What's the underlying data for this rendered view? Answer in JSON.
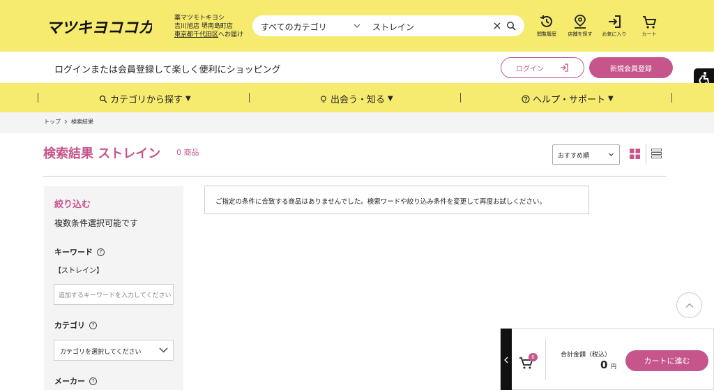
{
  "header": {
    "logo_text": "マツキヨココカラ",
    "store": {
      "line1": "薬マツモトキヨシ",
      "line2": "吉川旭店 堺南島町店",
      "line3_link": "東京都千代田区",
      "line3_suffix": "へお届け"
    },
    "search": {
      "category": "すべてのカテゴリ",
      "query": "ストレイン"
    },
    "icons": [
      {
        "label": "閲覧履歴",
        "icon": "history-icon"
      },
      {
        "label": "店舗を探す",
        "icon": "store-pin-icon"
      },
      {
        "label": "お気に入り",
        "icon": "favorite-enter-icon"
      },
      {
        "label": "カート",
        "icon": "cart-icon"
      }
    ]
  },
  "login_bar": {
    "message": "ログインまたは会員登録して楽しく便利にショッピング",
    "login_label": "ログイン",
    "register_label": "新規会員登録"
  },
  "nav": {
    "items": [
      {
        "label": "カテゴリから探す",
        "icon": "search-icon"
      },
      {
        "label": "出会う・知る",
        "icon": "lightbulb-icon"
      },
      {
        "label": "ヘルプ・サポート",
        "icon": "question-icon"
      }
    ],
    "arrow": "▼"
  },
  "breadcrumb": {
    "top": "トップ",
    "current": "検索結果"
  },
  "results": {
    "title": "検索結果 ストレイン",
    "count": "0 商品",
    "sort_selected": "おすすめ順",
    "empty_message": "ご指定の条件に合致する商品はありませんでした。検索ワードや絞り込み条件を変更して再度お試しください。"
  },
  "sidebar": {
    "title": "絞り込む",
    "subtitle": "複数条件選択可能です",
    "keyword_heading": "キーワード",
    "keyword_value": "【ストレイン】",
    "keyword_placeholder": "追加するキーワードを入力してください",
    "category_heading": "カテゴリ",
    "category_select": "カテゴリを選択してください",
    "maker_heading": "メーカー",
    "help_glyph": "?"
  },
  "cart": {
    "badge": "0",
    "total_label": "合計金額（税込）",
    "total_value": "0",
    "total_unit": "円",
    "button_label": "カートに進む"
  },
  "colors": {
    "brand_yellow": "#f6ea6f",
    "accent_pink": "#c5558b"
  }
}
